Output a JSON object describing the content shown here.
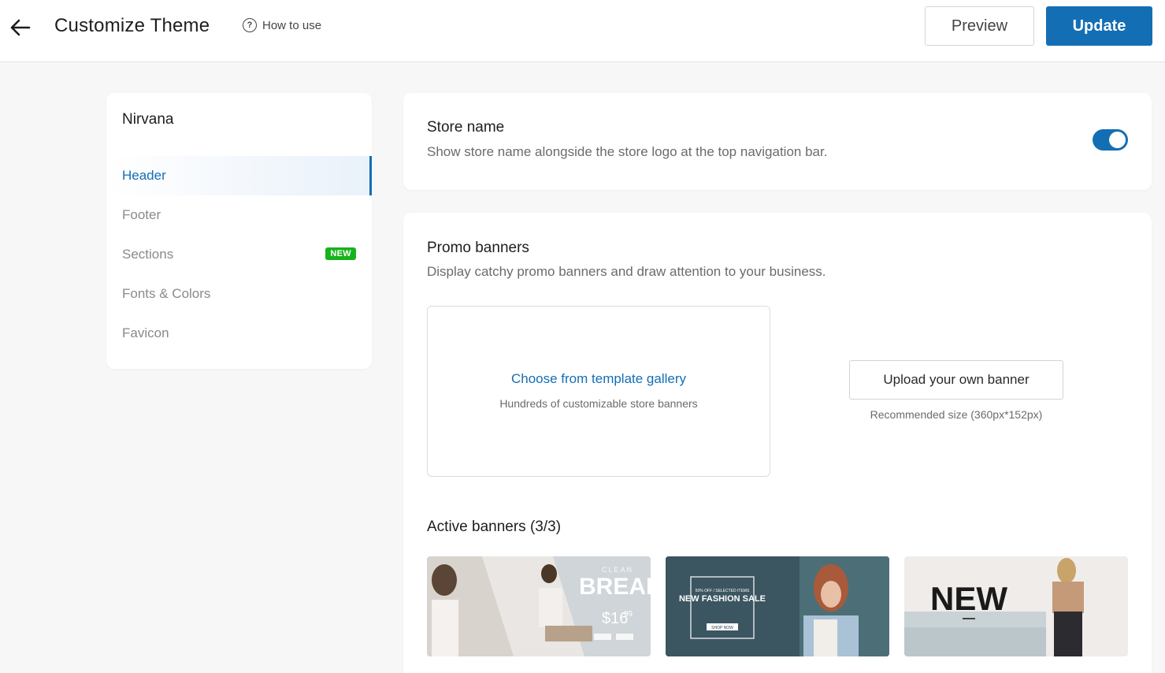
{
  "header": {
    "title": "Customize Theme",
    "help_label": "How to use",
    "preview_label": "Preview",
    "update_label": "Update"
  },
  "sidebar": {
    "theme_name": "Nirvana",
    "items": [
      {
        "label": "Header",
        "active": true
      },
      {
        "label": "Footer"
      },
      {
        "label": "Sections",
        "badge": "NEW"
      },
      {
        "label": "Fonts & Colors"
      },
      {
        "label": "Favicon"
      }
    ]
  },
  "store_name": {
    "title": "Store name",
    "description": "Show store name alongside the store logo at the top navigation bar.",
    "enabled": true
  },
  "promo": {
    "title": "Promo banners",
    "description": "Display catchy promo banners and draw attention to your business.",
    "gallery_link": "Choose from template gallery",
    "gallery_sub": "Hundreds of customizable store banners",
    "upload_label": "Upload your own banner",
    "upload_hint": "Recommended size (360px*152px)"
  },
  "active_banners": {
    "title": "Active banners (3/3)",
    "banners": [
      {
        "main": "BREAK",
        "tag": "CLEAN",
        "price": "$16",
        "cents": "99"
      },
      {
        "main": "NEW FASHION SALE",
        "tag": "50% OFF / SELECTED ITEMS",
        "cta": "SHOP NOW"
      },
      {
        "main": "NEW"
      }
    ]
  },
  "colors": {
    "accent": "#146eb4",
    "badge_green": "#17b31b"
  }
}
